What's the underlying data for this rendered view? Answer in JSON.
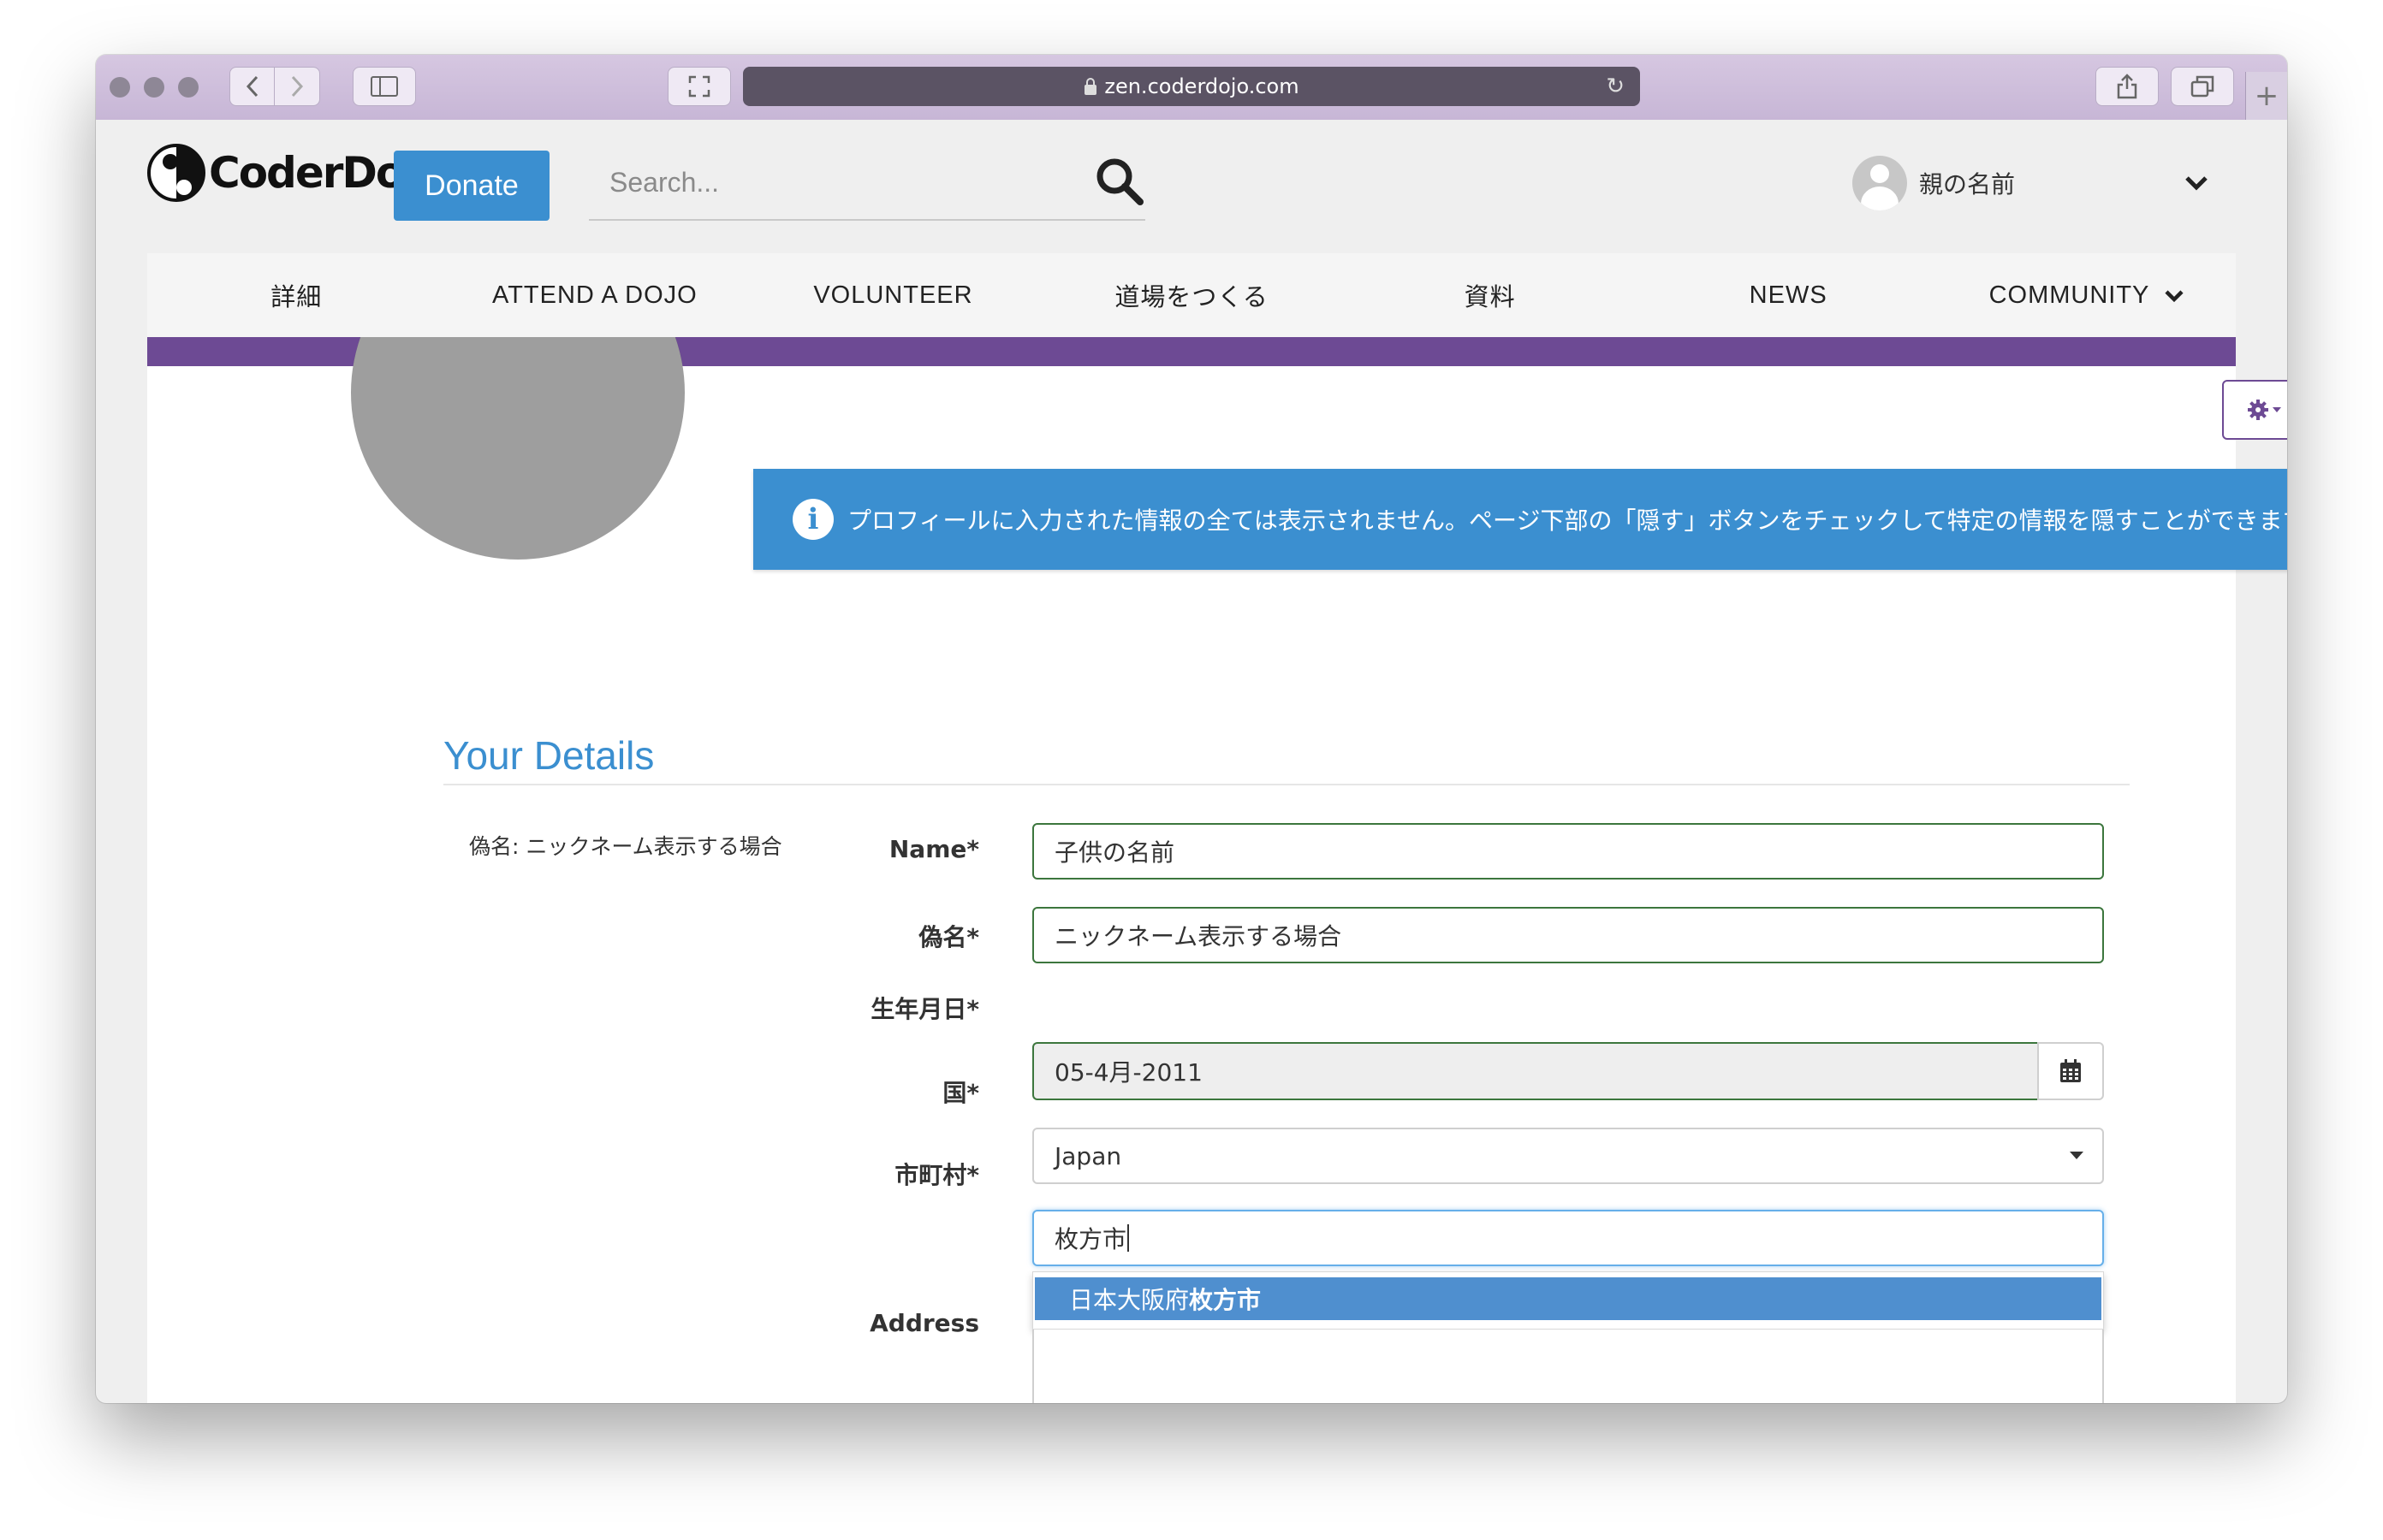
{
  "browser": {
    "url": "zen.coderdojo.com"
  },
  "header": {
    "logo_text": "CoderDojo",
    "donate_label": "Donate",
    "search_placeholder": "Search...",
    "user_name": "親の名前"
  },
  "nav": {
    "items": [
      {
        "label": "詳細"
      },
      {
        "label": "ATTEND A DOJO"
      },
      {
        "label": "VOLUNTEER"
      },
      {
        "label": "道場をつくる"
      },
      {
        "label": "資料"
      },
      {
        "label": "NEWS"
      },
      {
        "label": "COMMUNITY"
      }
    ]
  },
  "banner": {
    "text": "プロフィールに入力された情報の全ては表示されません。ページ下部の「隠す」ボタンをチェックして特定の情報を隠すことができます。"
  },
  "details": {
    "title": "Your Details",
    "alias_note": "偽名: ニックネーム表示する場合",
    "name_label": "Name*",
    "name_value": "子供の名前",
    "alias_label": "偽名*",
    "alias_value": "ニックネーム表示する場合",
    "dob_label": "生年月日*",
    "dob_value": "05-4月-2011",
    "country_label": "国*",
    "country_value": "Japan",
    "city_label": "市町村*",
    "city_value": "枚方市",
    "city_suggestion_prefix": "日本大阪府",
    "city_suggestion_match": "枚方市",
    "address_label": "Address"
  },
  "colors": {
    "accent_blue": "#3b8fd0",
    "brand_purple": "#6d4a94",
    "valid_green": "#3c763d"
  }
}
